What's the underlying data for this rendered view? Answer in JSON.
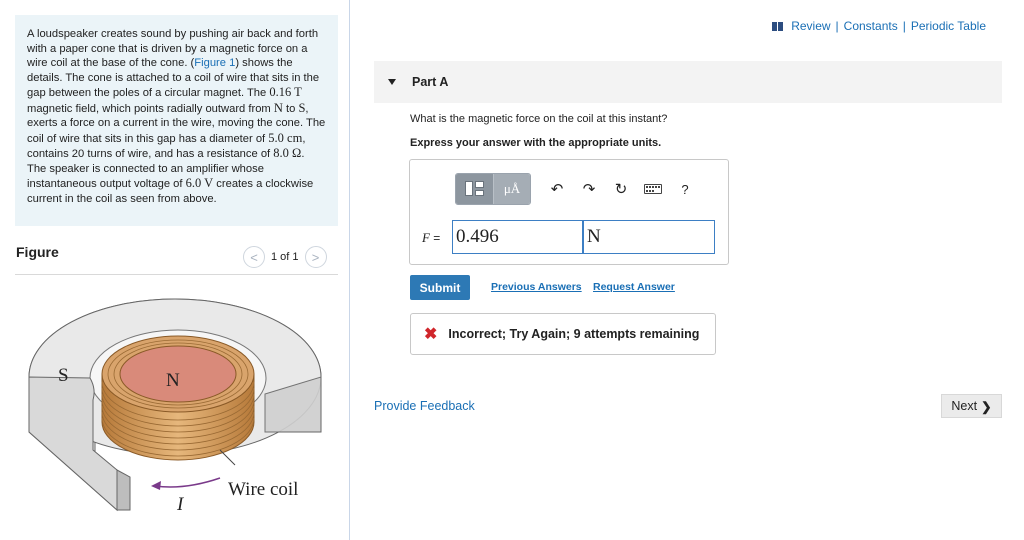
{
  "problem": {
    "text_1": "A loudspeaker creates sound by pushing air back and forth with a paper cone that is driven by a magnetic force on a wire coil at the base of the cone. (",
    "figure_link": "Figure 1",
    "text_2": ") shows the details. The cone is attached to a coil of wire that sits in the gap between the poles of a circular magnet. The ",
    "field_value": "0.16 T",
    "text_3": " magnetic field, which points radially outward from ",
    "pole_n": "N",
    "text_4": " to ",
    "pole_s": "S",
    "text_5": ", exerts a force on a current in the wire, moving the cone. The coil of wire that sits in this gap has a diameter of ",
    "diameter": "5.0 cm",
    "text_6": ", contains 20 turns of wire, and has a resistance of ",
    "resistance": "8.0 Ω",
    "text_7": ". The speaker is connected to an amplifier whose instantaneous output voltage of ",
    "voltage": "6.0 V",
    "text_8": " creates a clockwise current in the coil as seen from above."
  },
  "figure": {
    "heading": "Figure",
    "pager": "1 of 1",
    "prev": "<",
    "next": ">",
    "label_s": "S",
    "label_n": "N",
    "label_wire": "Wire coil",
    "label_i": "I"
  },
  "top_links": {
    "review": "Review",
    "sep": "|",
    "constants": "Constants",
    "periodic": "Periodic Table"
  },
  "part": {
    "label": "Part A",
    "question": "What is the magnetic force on the coil at this instant?",
    "instruction": "Express your answer with the appropriate units."
  },
  "toolbar": {
    "units_label": "μÅ",
    "help": "?"
  },
  "answer": {
    "var_label": "F",
    "equals": "=",
    "value": "0.496",
    "unit": "N"
  },
  "actions": {
    "submit": "Submit",
    "previous_answers": "Previous Answers",
    "request_answer": "Request Answer"
  },
  "feedback": {
    "message": "Incorrect; Try Again; 9 attempts remaining"
  },
  "footer": {
    "provide_feedback": "Provide Feedback",
    "next": "Next"
  },
  "colors": {
    "link": "#1a6fb5",
    "submit": "#2d79b5",
    "error": "#d0262b",
    "problem_bg": "#ebf4f8"
  }
}
